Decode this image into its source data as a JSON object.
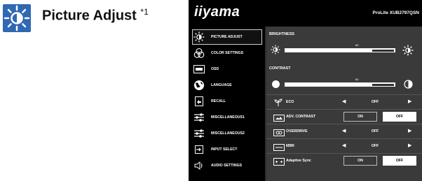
{
  "heading": {
    "title": "Picture Adjust",
    "note": "*1"
  },
  "osd": {
    "logo": "iiyama",
    "model": "ProLite XUB2797QSN",
    "menu": [
      {
        "label": "PICTURE ADJUST",
        "icon": "sun-icon",
        "active": true
      },
      {
        "label": "COLOR SETTINGS",
        "icon": "color-settings-icon"
      },
      {
        "label": "OSD",
        "icon": "osd-icon"
      },
      {
        "label": "LANGUAGE",
        "icon": "globe-icon"
      },
      {
        "label": "RECALL",
        "icon": "recall-icon"
      },
      {
        "label": "MISCELLANEOUS1",
        "icon": "sliders-icon"
      },
      {
        "label": "MISCELLANEOUS2",
        "icon": "sliders-icon"
      },
      {
        "label": "INPUT SELECT",
        "icon": "input-select-icon"
      },
      {
        "label": "AUDIO SETTINGS",
        "icon": "speaker-icon"
      }
    ],
    "brightness": {
      "label": "BRIGHTNESS",
      "value": "80",
      "level": 0.8
    },
    "contrast": {
      "label": "CONTRAST",
      "value": "80",
      "level": 0.8
    },
    "eco": {
      "label": "ECO",
      "value": "OFF"
    },
    "adv_contrast": {
      "label": "ADV. CONTRAST",
      "on": "ON",
      "off": "OFF",
      "selected": "OFF"
    },
    "overdrive": {
      "label": "OVERDRIVE",
      "value": "OFF"
    },
    "mbr": {
      "label": "MBR",
      "value": "OFF"
    },
    "adaptive_sync": {
      "label": "Adaptive Sync",
      "on": "ON",
      "off": "OFF",
      "selected": "OFF"
    },
    "colors": {
      "accent": "#2f68b3",
      "panel": "#3a3a3a",
      "menu": "#000000"
    }
  }
}
